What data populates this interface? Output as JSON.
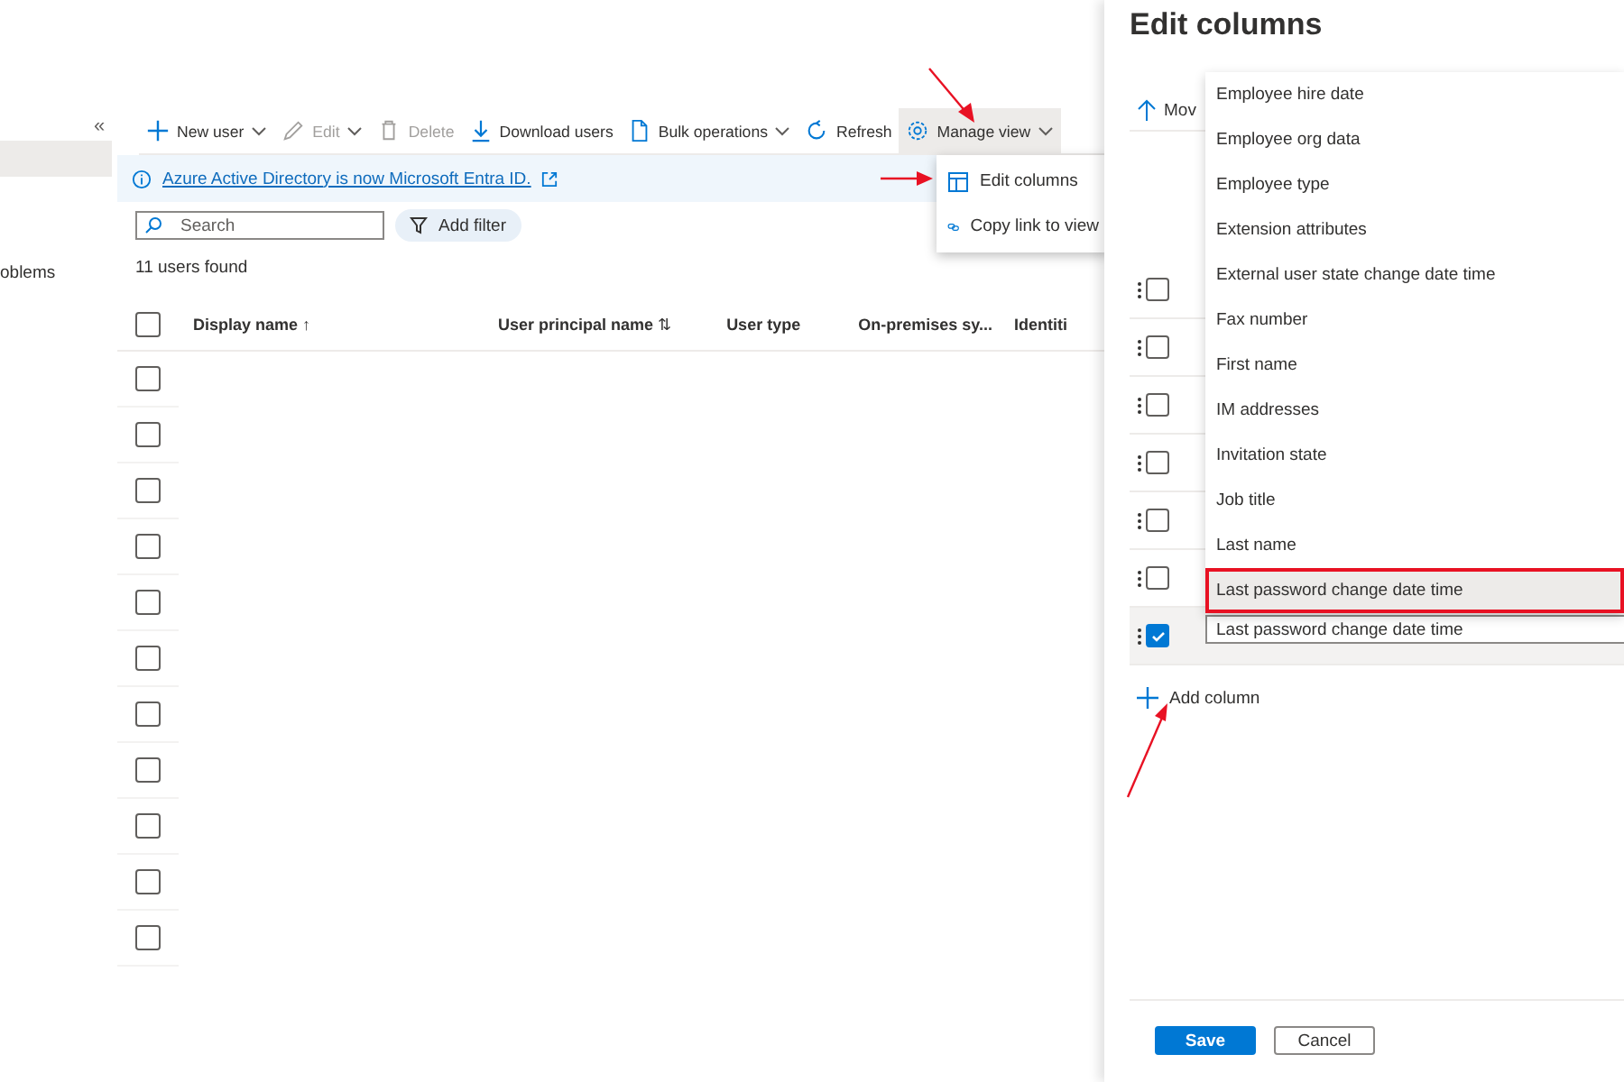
{
  "sidebar": {
    "collapse_glyph": "«",
    "items": [
      {
        "label": "oblems"
      }
    ]
  },
  "toolbar": [
    {
      "label": "New user",
      "disabled": false,
      "has_menu": true,
      "expanded": false
    },
    {
      "label": "Edit",
      "disabled": true,
      "has_menu": true,
      "expanded": false
    },
    {
      "label": "Delete",
      "disabled": true,
      "has_menu": false,
      "expanded": false
    },
    {
      "label": "Download users",
      "disabled": false,
      "has_menu": false,
      "expanded": false
    },
    {
      "label": "Bulk operations",
      "disabled": false,
      "has_menu": true,
      "expanded": false
    },
    {
      "label": "Refresh",
      "disabled": false,
      "has_menu": false,
      "expanded": false
    },
    {
      "label": "Manage view",
      "disabled": false,
      "has_menu": true,
      "expanded": true
    }
  ],
  "manage_view_menu": {
    "items": [
      {
        "label": "Edit columns"
      },
      {
        "label": "Copy link to view"
      }
    ]
  },
  "banner": {
    "link": "Azure Active Directory is now Microsoft Entra ID."
  },
  "search": {
    "placeholder": "Search"
  },
  "filter_button": "Add filter",
  "result_count": "11 users found",
  "table": {
    "all_selected": false,
    "columns": [
      {
        "label": "Display name",
        "sort_glyph": "↑"
      },
      {
        "label": "User principal name",
        "sort_glyph": "⇅"
      },
      {
        "label": "User type"
      },
      {
        "label": "On-premises sy..."
      },
      {
        "label": "Identiti"
      }
    ],
    "rows": [
      {
        "selected": false
      },
      {
        "selected": false
      },
      {
        "selected": false
      },
      {
        "selected": false
      },
      {
        "selected": false
      },
      {
        "selected": false
      },
      {
        "selected": false
      },
      {
        "selected": false
      },
      {
        "selected": false
      },
      {
        "selected": false
      },
      {
        "selected": false
      }
    ]
  },
  "panel": {
    "title": "Edit columns",
    "move_button": "Mov",
    "column_rows": [
      {
        "checked": false
      },
      {
        "checked": false
      },
      {
        "checked": false
      },
      {
        "checked": false
      },
      {
        "checked": false
      },
      {
        "checked": false
      },
      {
        "checked": true
      }
    ],
    "column_dropdown": {
      "value": "Last password change date time",
      "options": [
        {
          "label": "Employee hire date",
          "selected": false
        },
        {
          "label": "Employee org data",
          "selected": false
        },
        {
          "label": "Employee type",
          "selected": false
        },
        {
          "label": "Extension attributes",
          "selected": false
        },
        {
          "label": "External user state change date time",
          "selected": false
        },
        {
          "label": "Fax number",
          "selected": false
        },
        {
          "label": "First name",
          "selected": false
        },
        {
          "label": "IM addresses",
          "selected": false
        },
        {
          "label": "Invitation state",
          "selected": false
        },
        {
          "label": "Job title",
          "selected": false
        },
        {
          "label": "Last name",
          "selected": false
        },
        {
          "label": "Last password change date time",
          "selected": true
        }
      ]
    },
    "add_column": "Add column",
    "buttons": [
      {
        "label": "Save",
        "kind": "primary"
      },
      {
        "label": "Cancel",
        "kind": "secondary"
      }
    ]
  }
}
